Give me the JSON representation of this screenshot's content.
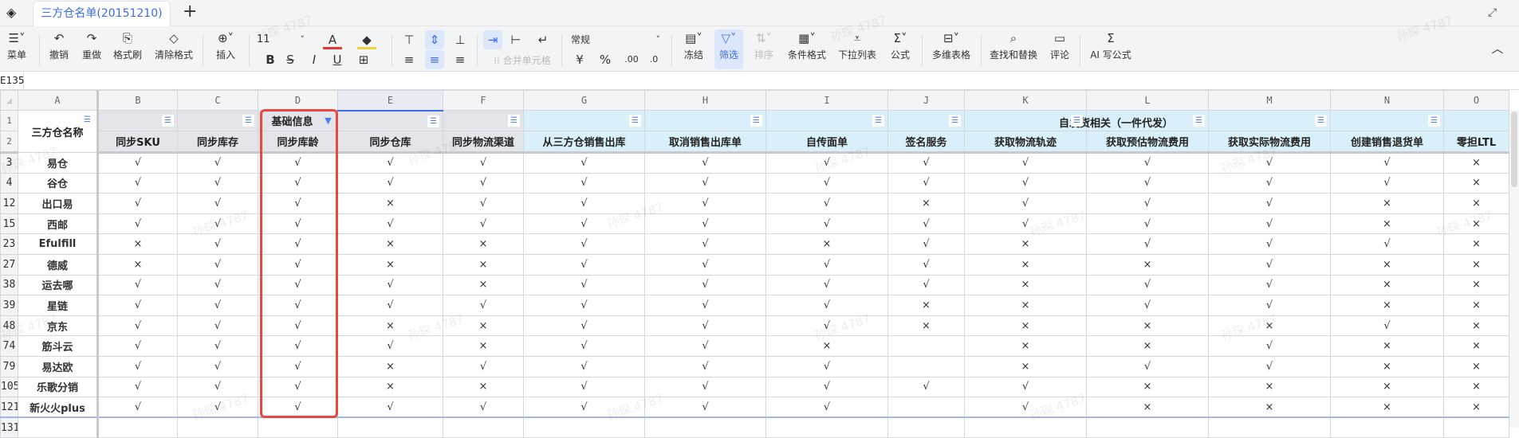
{
  "tabbar": {
    "sheet_tab": "三方仓名单(20151210)",
    "add_label": "+"
  },
  "toolbar": {
    "menu": "菜单",
    "undo": "撤销",
    "redo": "重做",
    "format_painter": "格式刷",
    "clear_format": "清除格式",
    "insert": "插入",
    "font_size": "11",
    "merge": "合并单元格",
    "number_format": "常规",
    "currency": "¥",
    "percent": "%",
    "inc_decimal": ".00",
    "dec_decimal": ".0",
    "freeze": "冻结",
    "filter": "筛选",
    "sort": "排序",
    "cond_format": "条件格式",
    "dropdown_list": "下拉列表",
    "formula": "公式",
    "multi_table": "多维表格",
    "find_replace": "查找和替换",
    "comment": "评论",
    "ai_formula": "AI 写公式"
  },
  "formula_bar": {
    "cell_ref": "E135"
  },
  "watermark": "孙琛 4787",
  "columns": [
    "A",
    "B",
    "C",
    "D",
    "E",
    "F",
    "G",
    "H",
    "I",
    "J",
    "K",
    "L",
    "M",
    "N",
    "O"
  ],
  "header": {
    "name_col": "三方仓名称",
    "group1": "基础信息",
    "group2": "自发货相关（一件代发）",
    "fields": [
      "同步SKU",
      "同步库存",
      "同步库龄",
      "同步仓库",
      "同步物流渠道",
      "从三方仓销售出库",
      "取消销售出库单",
      "自传面单",
      "签名服务",
      "获取物流轨迹",
      "获取预估物流费用",
      "获取实际物流费用",
      "创建销售退货单",
      "零担LTL"
    ]
  },
  "rows": [
    {
      "num": "3",
      "name": "易仓",
      "v": [
        "√",
        "√",
        "√",
        "√",
        "√",
        "√",
        "√",
        "√",
        "√",
        "√",
        "√",
        "√",
        "√",
        "×"
      ]
    },
    {
      "num": "4",
      "name": "谷仓",
      "v": [
        "√",
        "√",
        "√",
        "√",
        "√",
        "√",
        "√",
        "√",
        "√",
        "√",
        "√",
        "√",
        "√",
        "×"
      ]
    },
    {
      "num": "12",
      "name": "出口易",
      "v": [
        "√",
        "√",
        "√",
        "×",
        "√",
        "√",
        "√",
        "√",
        "×",
        "√",
        "√",
        "√",
        "×",
        "×"
      ]
    },
    {
      "num": "15",
      "name": "西邮",
      "v": [
        "√",
        "√",
        "√",
        "√",
        "√",
        "√",
        "√",
        "√",
        "√",
        "√",
        "√",
        "√",
        "×",
        "×"
      ]
    },
    {
      "num": "23",
      "name": "Efulfill",
      "v": [
        "×",
        "√",
        "√",
        "×",
        "×",
        "√",
        "√",
        "×",
        "√",
        "×",
        "√",
        "√",
        "√",
        "×"
      ]
    },
    {
      "num": "27",
      "name": "德威",
      "v": [
        "×",
        "√",
        "√",
        "×",
        "×",
        "√",
        "√",
        "√",
        "√",
        "×",
        "×",
        "√",
        "×",
        "×"
      ]
    },
    {
      "num": "38",
      "name": "运去哪",
      "v": [
        "√",
        "√",
        "√",
        "√",
        "×",
        "√",
        "√",
        "√",
        "√",
        "×",
        "√",
        "√",
        "×",
        "×"
      ]
    },
    {
      "num": "39",
      "name": "星链",
      "v": [
        "√",
        "√",
        "√",
        "√",
        "√",
        "√",
        "√",
        "√",
        "×",
        "×",
        "√",
        "√",
        "×",
        "×"
      ]
    },
    {
      "num": "48",
      "name": "京东",
      "v": [
        "√",
        "√",
        "√",
        "×",
        "×",
        "√",
        "√",
        "√",
        "×",
        "×",
        "×",
        "×",
        "√",
        "×"
      ]
    },
    {
      "num": "74",
      "name": "筋斗云",
      "v": [
        "√",
        "√",
        "√",
        "√",
        "×",
        "√",
        "√",
        "×",
        "",
        "×",
        "×",
        "√",
        "×",
        "×"
      ]
    },
    {
      "num": "79",
      "name": "易达欧",
      "v": [
        "√",
        "√",
        "√",
        "×",
        "√",
        "√",
        "√",
        "√",
        "",
        "×",
        "√",
        "√",
        "×",
        "×"
      ]
    },
    {
      "num": "105",
      "name": "乐歌分销",
      "v": [
        "√",
        "√",
        "√",
        "×",
        "×",
        "√",
        "√",
        "√",
        "√",
        "√",
        "×",
        "×",
        "×",
        "×"
      ]
    },
    {
      "num": "121",
      "name": "新火火plus",
      "v": [
        "√",
        "√",
        "√",
        "√",
        "√",
        "√",
        "√",
        "√",
        "",
        "√",
        "×",
        "×",
        "×",
        "×"
      ]
    }
  ],
  "next_row_num": "131"
}
